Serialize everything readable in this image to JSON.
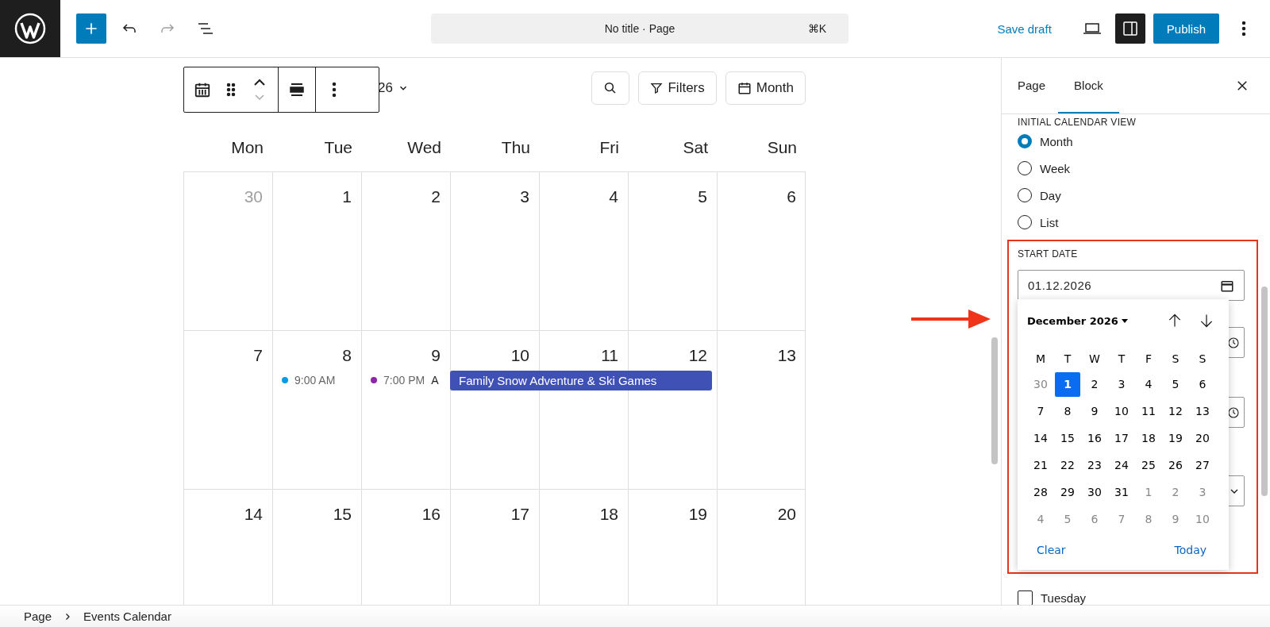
{
  "top_bar": {
    "title": "No title · Page",
    "shortcut": "⌘K",
    "save_draft": "Save draft",
    "publish": "Publish"
  },
  "calendar": {
    "month_title": "26",
    "filters": "Filters",
    "view": "Month",
    "weekdays": [
      "Mon",
      "Tue",
      "Wed",
      "Thu",
      "Fri",
      "Sat",
      "Sun"
    ],
    "weeks": [
      {
        "days": [
          {
            "day": "30",
            "muted": true
          },
          {
            "day": "1",
            "muted": false
          },
          {
            "day": "2",
            "muted": false
          },
          {
            "day": "3",
            "muted": false
          },
          {
            "day": "4",
            "muted": false
          },
          {
            "day": "5",
            "muted": false
          },
          {
            "day": "6",
            "muted": false
          }
        ]
      },
      {
        "days": [
          {
            "day": "7",
            "muted": false
          },
          {
            "day": "8",
            "muted": false,
            "events": [
              {
                "kind": "timed",
                "time": "9:00 AM",
                "color": "#039be5"
              }
            ]
          },
          {
            "day": "9",
            "muted": false,
            "events": [
              {
                "kind": "timed",
                "time": "7:00 PM",
                "title": "A",
                "color": "#8e24aa"
              }
            ]
          },
          {
            "day": "10",
            "muted": false,
            "events": [
              {
                "kind": "bar",
                "title": "Family Snow Adventure & Ski Games",
                "color": "#3f51b5"
              }
            ]
          },
          {
            "day": "11",
            "muted": false,
            "events": [
              {
                "kind": "continuation"
              }
            ]
          },
          {
            "day": "12",
            "muted": false,
            "events": [
              {
                "kind": "continuation"
              }
            ]
          },
          {
            "day": "13",
            "muted": false
          }
        ]
      },
      {
        "days": [
          {
            "day": "14",
            "muted": false
          },
          {
            "day": "15",
            "muted": false
          },
          {
            "day": "16",
            "muted": false
          },
          {
            "day": "17",
            "muted": false
          },
          {
            "day": "18",
            "muted": false
          },
          {
            "day": "19",
            "muted": false
          },
          {
            "day": "20",
            "muted": false
          }
        ]
      }
    ]
  },
  "sidebar": {
    "tabs": [
      {
        "label": "Page",
        "selected": false
      },
      {
        "label": "Block",
        "selected": true
      }
    ],
    "view_heading": "INITIAL CALENDAR VIEW",
    "views": [
      {
        "label": "Month",
        "selected": true
      },
      {
        "label": "Week",
        "selected": false
      },
      {
        "label": "Day",
        "selected": false
      },
      {
        "label": "List",
        "selected": false
      }
    ],
    "start_date": {
      "label": "START DATE",
      "value": "01.12.2026"
    },
    "date_picker": {
      "month": "December 2026",
      "weekdays": [
        "M",
        "T",
        "W",
        "T",
        "F",
        "S",
        "S"
      ],
      "weeks": [
        [
          {
            "day": "30",
            "muted": true,
            "selected": false
          },
          {
            "day": "1",
            "muted": false,
            "selected": true
          },
          {
            "day": "2",
            "muted": false,
            "selected": false
          },
          {
            "day": "3",
            "muted": false,
            "selected": false
          },
          {
            "day": "4",
            "muted": false,
            "selected": false
          },
          {
            "day": "5",
            "muted": false,
            "selected": false
          },
          {
            "day": "6",
            "muted": false,
            "selected": false
          }
        ],
        [
          {
            "day": "7",
            "muted": false,
            "selected": false
          },
          {
            "day": "8",
            "muted": false,
            "selected": false
          },
          {
            "day": "9",
            "muted": false,
            "selected": false
          },
          {
            "day": "10",
            "muted": false,
            "selected": false
          },
          {
            "day": "11",
            "muted": false,
            "selected": false
          },
          {
            "day": "12",
            "muted": false,
            "selected": false
          },
          {
            "day": "13",
            "muted": false,
            "selected": false
          }
        ],
        [
          {
            "day": "14",
            "muted": false,
            "selected": false
          },
          {
            "day": "15",
            "muted": false,
            "selected": false
          },
          {
            "day": "16",
            "muted": false,
            "selected": false
          },
          {
            "day": "17",
            "muted": false,
            "selected": false
          },
          {
            "day": "18",
            "muted": false,
            "selected": false
          },
          {
            "day": "19",
            "muted": false,
            "selected": false
          },
          {
            "day": "20",
            "muted": false,
            "selected": false
          }
        ],
        [
          {
            "day": "21",
            "muted": false,
            "selected": false
          },
          {
            "day": "22",
            "muted": false,
            "selected": false
          },
          {
            "day": "23",
            "muted": false,
            "selected": false
          },
          {
            "day": "24",
            "muted": false,
            "selected": false
          },
          {
            "day": "25",
            "muted": false,
            "selected": false
          },
          {
            "day": "26",
            "muted": false,
            "selected": false
          },
          {
            "day": "27",
            "muted": false,
            "selected": false
          }
        ],
        [
          {
            "day": "28",
            "muted": false,
            "selected": false
          },
          {
            "day": "29",
            "muted": false,
            "selected": false
          },
          {
            "day": "30",
            "muted": false,
            "selected": false
          },
          {
            "day": "31",
            "muted": false,
            "selected": false
          },
          {
            "day": "1",
            "muted": true,
            "selected": false
          },
          {
            "day": "2",
            "muted": true,
            "selected": false
          },
          {
            "day": "3",
            "muted": true,
            "selected": false
          }
        ],
        [
          {
            "day": "4",
            "muted": true,
            "selected": false
          },
          {
            "day": "5",
            "muted": true,
            "selected": false
          },
          {
            "day": "6",
            "muted": true,
            "selected": false
          },
          {
            "day": "7",
            "muted": true,
            "selected": false
          },
          {
            "day": "8",
            "muted": true,
            "selected": false
          },
          {
            "day": "9",
            "muted": true,
            "selected": false
          },
          {
            "day": "10",
            "muted": true,
            "selected": false
          }
        ]
      ],
      "clear": "Clear",
      "today": "Today"
    },
    "checkboxes": [
      {
        "label": "Tuesday",
        "checked": false
      }
    ]
  },
  "breadcrumb": [
    "Page",
    "Events Calendar"
  ]
}
